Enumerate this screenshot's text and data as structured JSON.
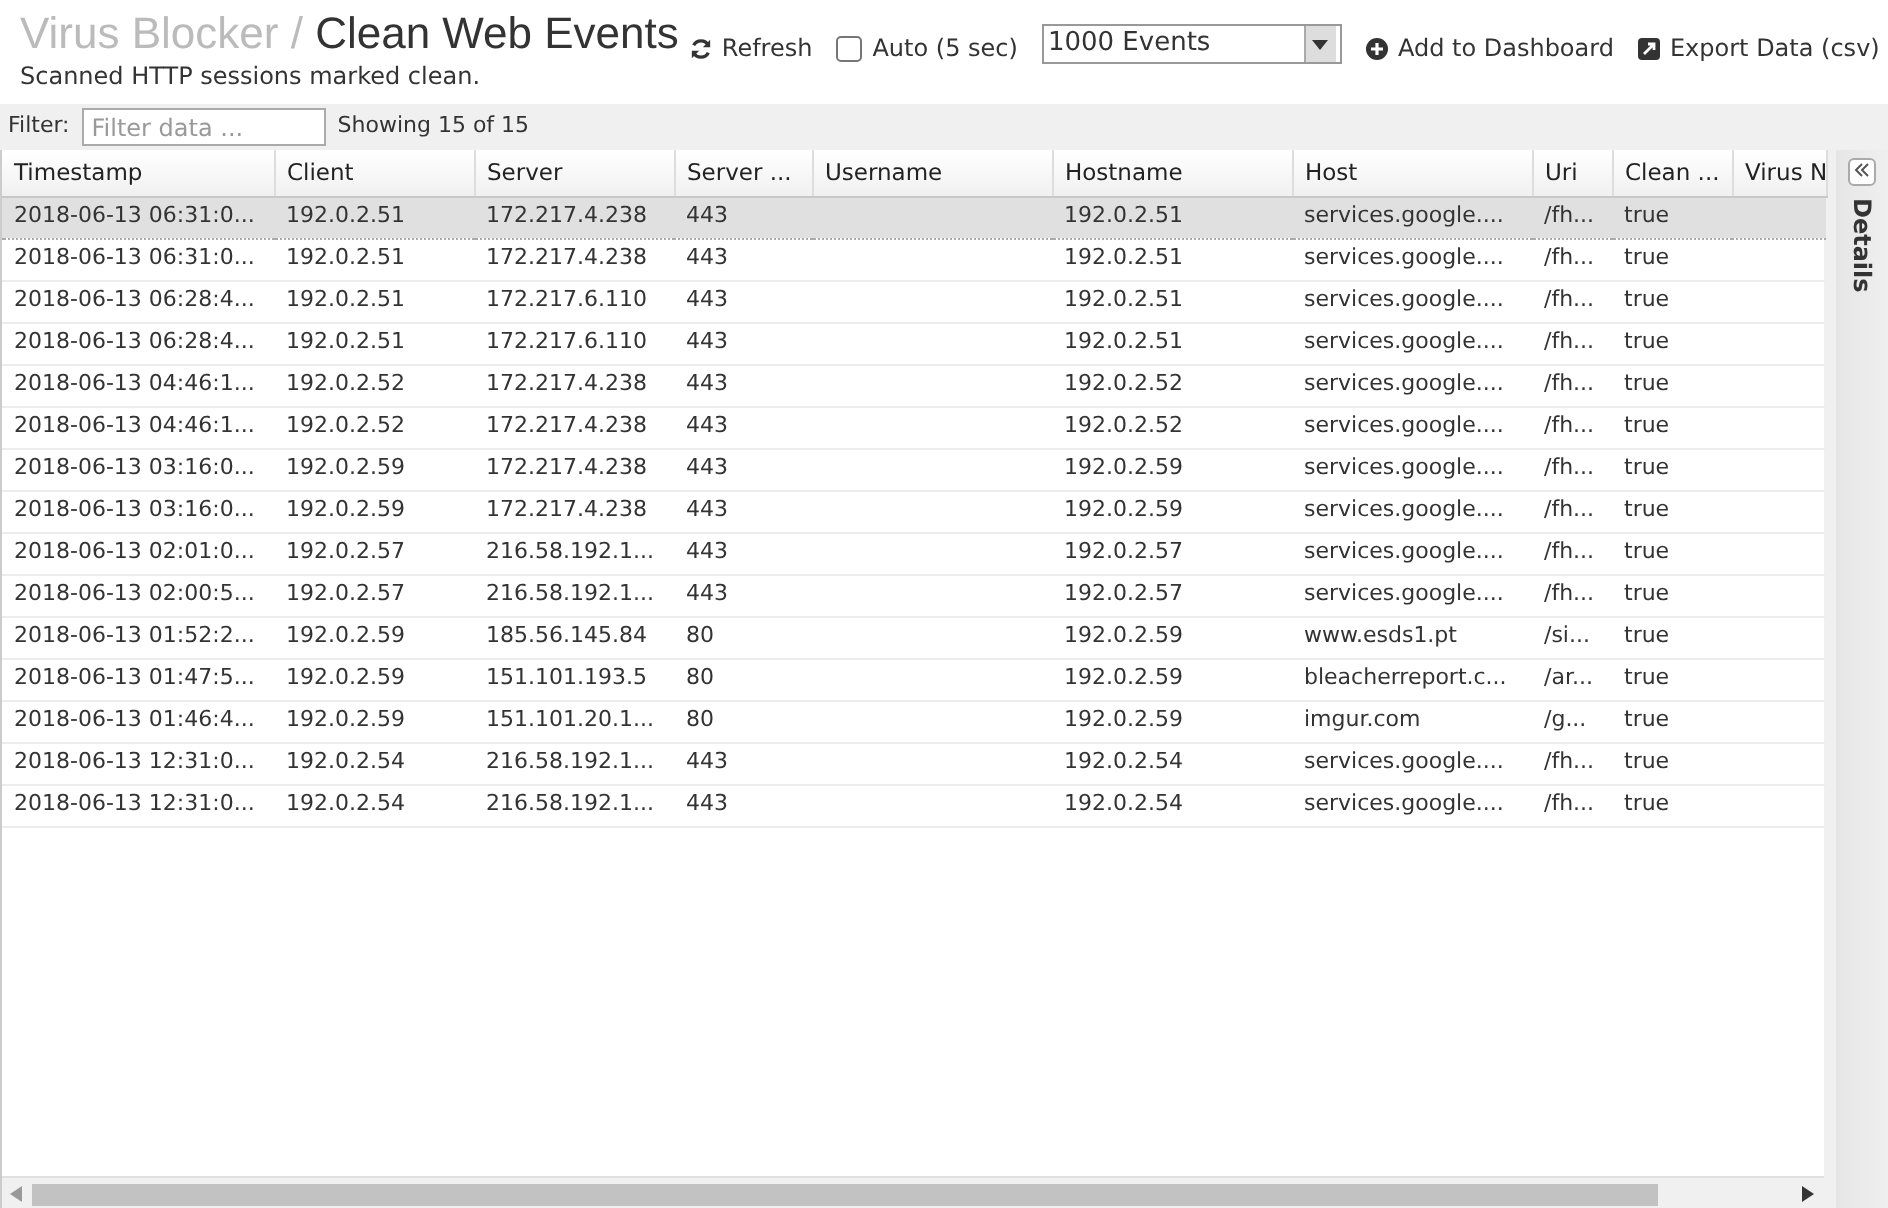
{
  "header": {
    "app": "Virus Blocker",
    "separator": "/",
    "title": "Clean Web Events",
    "subtitle": "Scanned HTTP sessions marked clean."
  },
  "toolbar": {
    "refresh": "Refresh",
    "auto": {
      "label": "Auto (5 sec)",
      "checked": false
    },
    "limit": "1000 Events",
    "add": "Add to Dashboard",
    "export": "Export Data (csv)"
  },
  "filter": {
    "label": "Filter:",
    "placeholder": "Filter data ...",
    "count": "Showing 15 of 15"
  },
  "table": {
    "columns": [
      "Timestamp",
      "Client",
      "Server",
      "Server ...",
      "Username",
      "Hostname",
      "Host",
      "Uri",
      "Clean ...",
      "Virus N"
    ],
    "rows": [
      {
        "selected": true,
        "cells": [
          "2018-06-13 06:31:0...",
          "192.0.2.51",
          "172.217.4.238",
          "443",
          "",
          "192.0.2.51",
          "services.google....",
          "/fh...",
          "true",
          ""
        ]
      },
      {
        "selected": false,
        "cells": [
          "2018-06-13 06:31:0...",
          "192.0.2.51",
          "172.217.4.238",
          "443",
          "",
          "192.0.2.51",
          "services.google....",
          "/fh...",
          "true",
          ""
        ]
      },
      {
        "selected": false,
        "cells": [
          "2018-06-13 06:28:4...",
          "192.0.2.51",
          "172.217.6.110",
          "443",
          "",
          "192.0.2.51",
          "services.google....",
          "/fh...",
          "true",
          ""
        ]
      },
      {
        "selected": false,
        "cells": [
          "2018-06-13 06:28:4...",
          "192.0.2.51",
          "172.217.6.110",
          "443",
          "",
          "192.0.2.51",
          "services.google....",
          "/fh...",
          "true",
          ""
        ]
      },
      {
        "selected": false,
        "cells": [
          "2018-06-13 04:46:1...",
          "192.0.2.52",
          "172.217.4.238",
          "443",
          "",
          "192.0.2.52",
          "services.google....",
          "/fh...",
          "true",
          ""
        ]
      },
      {
        "selected": false,
        "cells": [
          "2018-06-13 04:46:1...",
          "192.0.2.52",
          "172.217.4.238",
          "443",
          "",
          "192.0.2.52",
          "services.google....",
          "/fh...",
          "true",
          ""
        ]
      },
      {
        "selected": false,
        "cells": [
          "2018-06-13 03:16:0...",
          "192.0.2.59",
          "172.217.4.238",
          "443",
          "",
          "192.0.2.59",
          "services.google....",
          "/fh...",
          "true",
          ""
        ]
      },
      {
        "selected": false,
        "cells": [
          "2018-06-13 03:16:0...",
          "192.0.2.59",
          "172.217.4.238",
          "443",
          "",
          "192.0.2.59",
          "services.google....",
          "/fh...",
          "true",
          ""
        ]
      },
      {
        "selected": false,
        "cells": [
          "2018-06-13 02:01:0...",
          "192.0.2.57",
          "216.58.192.1...",
          "443",
          "",
          "192.0.2.57",
          "services.google....",
          "/fh...",
          "true",
          ""
        ]
      },
      {
        "selected": false,
        "cells": [
          "2018-06-13 02:00:5...",
          "192.0.2.57",
          "216.58.192.1...",
          "443",
          "",
          "192.0.2.57",
          "services.google....",
          "/fh...",
          "true",
          ""
        ]
      },
      {
        "selected": false,
        "cells": [
          "2018-06-13 01:52:2...",
          "192.0.2.59",
          "185.56.145.84",
          "80",
          "",
          "192.0.2.59",
          "www.esds1.pt",
          "/si...",
          "true",
          ""
        ]
      },
      {
        "selected": false,
        "cells": [
          "2018-06-13 01:47:5...",
          "192.0.2.59",
          "151.101.193.5",
          "80",
          "",
          "192.0.2.59",
          "bleacherreport.c...",
          "/ar...",
          "true",
          ""
        ]
      },
      {
        "selected": false,
        "cells": [
          "2018-06-13 01:46:4...",
          "192.0.2.59",
          "151.101.20.1...",
          "80",
          "",
          "192.0.2.59",
          "imgur.com",
          "/g...",
          "true",
          ""
        ]
      },
      {
        "selected": false,
        "cells": [
          "2018-06-13 12:31:0...",
          "192.0.2.54",
          "216.58.192.1...",
          "443",
          "",
          "192.0.2.54",
          "services.google....",
          "/fh...",
          "true",
          ""
        ]
      },
      {
        "selected": false,
        "cells": [
          "2018-06-13 12:31:0...",
          "192.0.2.54",
          "216.58.192.1...",
          "443",
          "",
          "192.0.2.54",
          "services.google....",
          "/fh...",
          "true",
          ""
        ]
      }
    ]
  },
  "details": {
    "label": "Details"
  }
}
